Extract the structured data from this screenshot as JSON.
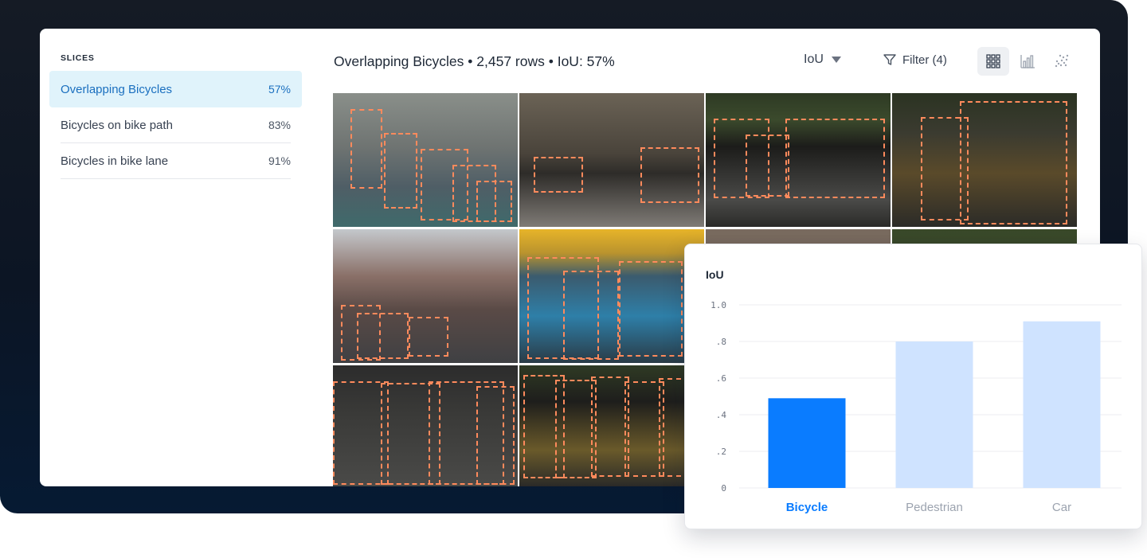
{
  "sidebar": {
    "heading": "SLICES",
    "items": [
      {
        "label": "Overlapping Bicycles",
        "pct": "57%",
        "active": true
      },
      {
        "label": "Bicycles on bike path",
        "pct": "83%",
        "active": false
      },
      {
        "label": "Bicycles in bike lane",
        "pct": "91%",
        "active": false
      }
    ]
  },
  "header": {
    "title": "Overlapping Bicycles • 2,457 rows • IoU: 57%",
    "metric": "IoU",
    "filter_label": "Filter (4)"
  },
  "icons": {
    "caret": "chevron-down-icon",
    "filter": "filter-icon",
    "grid_view": "grid-view-icon",
    "bar_view": "bar-chart-icon",
    "scatter_view": "scatter-plot-icon"
  },
  "colors": {
    "accent": "#1a6fbf",
    "active_bg": "#e0f3fb",
    "bar_selected": "#0a7cff",
    "bar_default": "#cfe3ff",
    "bbox": "#ff8a5c"
  },
  "chart_data": {
    "type": "bar",
    "title": "IoU",
    "categories": [
      "Bicycle",
      "Pedestrian",
      "Car"
    ],
    "values": [
      0.49,
      0.8,
      0.91
    ],
    "selected": "Bicycle",
    "ylim": [
      0,
      1.0
    ],
    "yticks": [
      "0",
      ".2",
      ".4",
      ".6",
      ".8",
      "1.0"
    ],
    "grid": true
  }
}
